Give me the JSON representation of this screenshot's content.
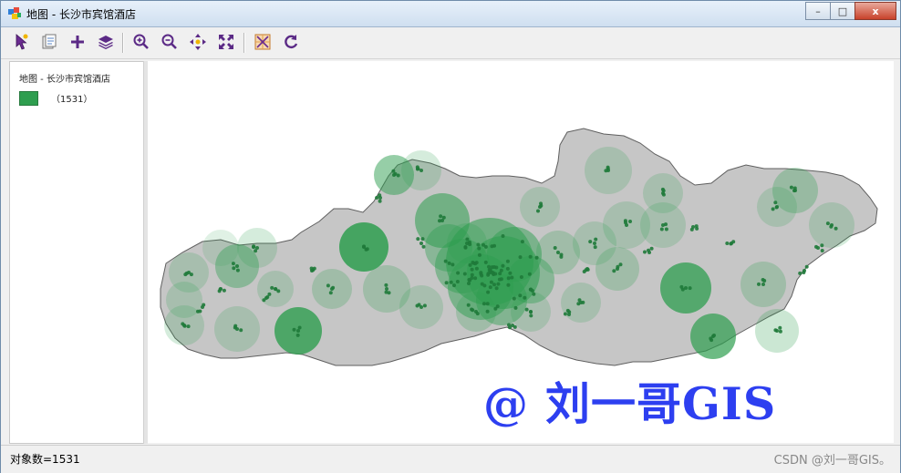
{
  "window": {
    "title": "地图 - 长沙市宾馆酒店"
  },
  "controls": {
    "minimize": "–",
    "maximize": "□",
    "close": "x"
  },
  "toolbar": {
    "buttons": [
      "select-tool",
      "identify-tool",
      "add-tool",
      "layers-tool",
      "zoom-in-tool",
      "zoom-out-tool",
      "pan-tool",
      "full-extent-tool",
      "clear-selection-tool",
      "refresh-tool"
    ]
  },
  "legend": {
    "title": "地图 - 长沙市宾馆酒店",
    "count": "（1531）",
    "color": "#2e9e4f"
  },
  "map": {
    "region_color": "#c6c6c6",
    "point_color": "#2e9e4f",
    "watermark": "@ 刘一哥GIS"
  },
  "status": {
    "text": "对象数=1531"
  },
  "credit": "CSDN @刘一哥GIS。"
}
